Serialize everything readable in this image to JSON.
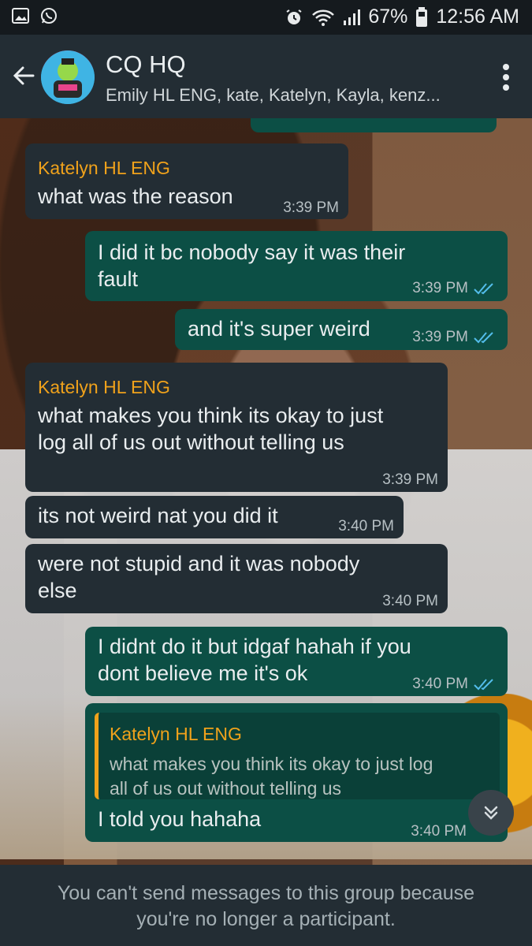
{
  "status_bar": {
    "battery": "67%",
    "time": "12:56 AM",
    "icons": [
      "gallery-icon",
      "whatsapp-icon",
      "alarm-icon",
      "wifi-icon",
      "signal-icon",
      "battery-icon"
    ]
  },
  "header": {
    "title": "CQ HQ",
    "subtitle": "Emily HL ENG, kate, Katelyn, Kayla, kenz..."
  },
  "messages": [
    {
      "direction": "in",
      "sender": "Katelyn HL ENG",
      "text": "what was the reason",
      "time": "3:39 PM"
    },
    {
      "direction": "out",
      "text": "I did it bc nobody say it was their\nfault",
      "time": "3:39 PM",
      "read": true
    },
    {
      "direction": "out",
      "text": "and it's super weird",
      "time": "3:39 PM",
      "read": true
    },
    {
      "direction": "in",
      "sender": "Katelyn HL ENG",
      "text": "what makes you think its okay to just\nlog all of us out without telling us",
      "time": "3:39 PM"
    },
    {
      "direction": "in",
      "text": "its not weird nat you did it",
      "time": "3:40 PM"
    },
    {
      "direction": "in",
      "text": "were not stupid and it was nobody\nelse",
      "time": "3:40 PM"
    },
    {
      "direction": "out",
      "text": "I didnt do it but idgaf hahah if you\ndont believe me it's ok",
      "time": "3:40 PM",
      "read": true
    },
    {
      "direction": "out",
      "quote": {
        "sender": "Katelyn HL ENG",
        "text": "what makes you think its okay to just log\nall of us out without telling us"
      },
      "text": "I told you hahaha",
      "time": "3:40 PM"
    }
  ],
  "footer": {
    "notice": "You can't send messages to this group because\nyou're no longer a participant."
  },
  "colors": {
    "incoming_bubble": "#232d34",
    "outgoing_bubble": "#0c4f45",
    "sender_name": "#f0a21b",
    "read_ticks": "#53bdeb"
  }
}
